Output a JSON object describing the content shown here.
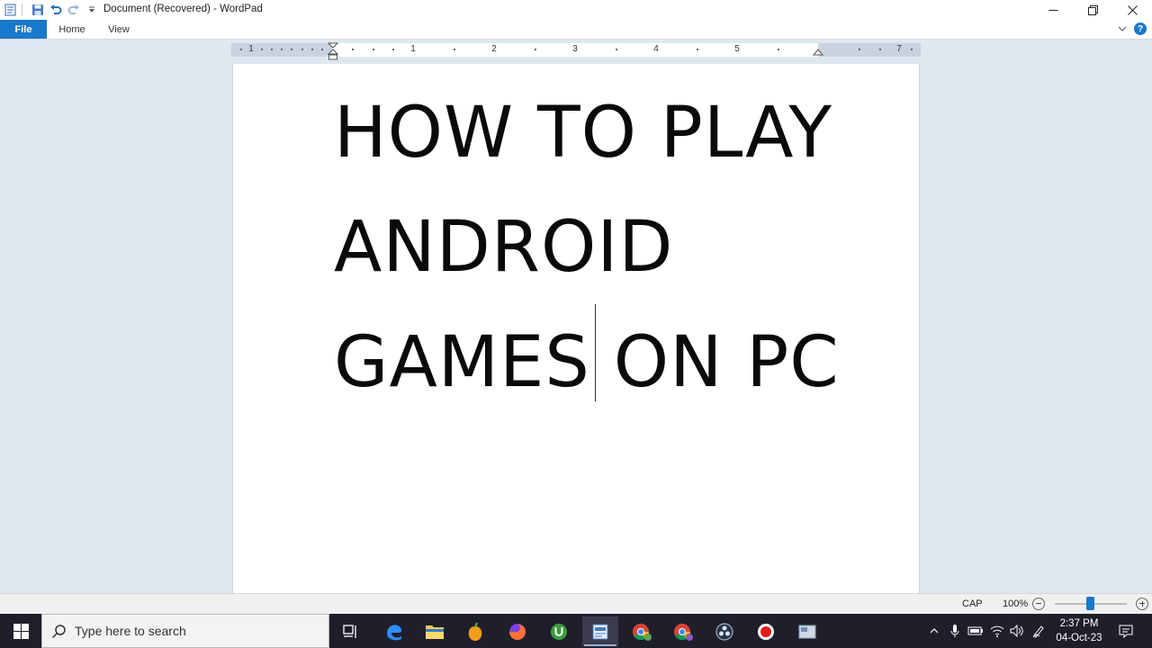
{
  "window": {
    "title": "Document (Recovered) - WordPad",
    "controls": {
      "minimize": "minimize",
      "restore": "restore",
      "close": "close"
    }
  },
  "quick_access": {
    "icons": [
      "wordpad-icon",
      "save-icon",
      "undo-icon",
      "redo-icon",
      "customize-qat-icon"
    ]
  },
  "ribbon": {
    "tabs": [
      {
        "label": "File",
        "active": true
      },
      {
        "label": "Home",
        "active": false
      },
      {
        "label": "View",
        "active": false
      }
    ],
    "help_label": "?"
  },
  "ruler": {
    "labels": [
      "1",
      "1",
      "2",
      "3",
      "4",
      "5",
      "7"
    ]
  },
  "document": {
    "lines": [
      "HOW TO PLAY",
      "ANDROID",
      "GAMES ON PC"
    ]
  },
  "statusbar": {
    "caps": "CAP",
    "zoom": "100%"
  },
  "taskbar": {
    "search_placeholder": "Type here to search",
    "time": "2:37 PM",
    "date": "04-Oct-23",
    "accent": "#1979ca"
  }
}
